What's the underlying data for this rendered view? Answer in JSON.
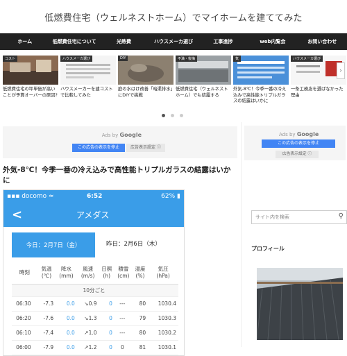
{
  "site": {
    "title": "低燃費住宅（ウェルネストホーム）でマイホームを建ててみた"
  },
  "nav": {
    "items": [
      "ホーム",
      "低燃費住宅について",
      "光熱費",
      "ハウスメーカ選び",
      "工事進捗",
      "web内覧会",
      "お問い合わせ"
    ]
  },
  "carousel": {
    "cards": [
      {
        "category": "コスト",
        "title": "低燃費住宅の坪単価が高いことが予算オーバーの原因?"
      },
      {
        "category": "ハウスメーカ選び",
        "title": "ハウスメーカーを建コストで比較してみた"
      },
      {
        "category": "DIY",
        "title": "庭の水はけ改善「暗渠排水」にDIYで挑戦"
      },
      {
        "category": "不満・後悔",
        "title": "低燃費住宅（ウェルネストホーム）でも結露する"
      },
      {
        "category": "気",
        "title": "外気-8℃！今季一番の冷え込みで高性能トリプルガラスの結露はいかに"
      },
      {
        "category": "ハウスメーカ選び",
        "title": "一条工務店を選ばなかった理由"
      }
    ],
    "next_icon": "chevron-right-icon"
  },
  "ads": {
    "ads_by": "Ads by",
    "google": "Google",
    "stop_label": "この広告の表示を停止",
    "settings_label": "広告表示設定 ⓘ"
  },
  "post": {
    "title": "外気-8℃！今季一番の冷え込みで高性能トリプルガラスの結露はいかに"
  },
  "phone": {
    "carrier": "docomo",
    "time": "6:52",
    "battery": "62%",
    "screen_title": "アメダス",
    "tab_today": "今日：2月7日（金）",
    "tab_yesterday": "昨日：2月6日（木）",
    "table": {
      "headers": [
        "時刻",
        "気温\n(℃)",
        "降水\n(mm)",
        "風速\n(m/s)",
        "日照\n(h)",
        "積雪\n(cm)",
        "湿度\n(%)",
        "気圧\n(hPa)"
      ],
      "group_label": "10分ごと",
      "rows": [
        [
          "06:30",
          "-7.3",
          "0.0",
          "↘0.9",
          "0",
          "---",
          "80",
          "1030.4"
        ],
        [
          "06:20",
          "-7.6",
          "0.0",
          "↘1.3",
          "0",
          "---",
          "79",
          "1030.3"
        ],
        [
          "06:10",
          "-7.4",
          "0.0",
          "↗1.0",
          "0",
          "---",
          "80",
          "1030.2"
        ],
        [
          "06:00",
          "-7.9",
          "0.0",
          "↗1.2",
          "0",
          "0",
          "81",
          "1030.1"
        ]
      ]
    }
  },
  "sidebar": {
    "search_placeholder": "サイト内を検索",
    "profile_label": "プロフィール"
  },
  "colors": {
    "accent": "#3a9de8",
    "nav_bg": "#222222",
    "ad_button": "#4285f4"
  }
}
